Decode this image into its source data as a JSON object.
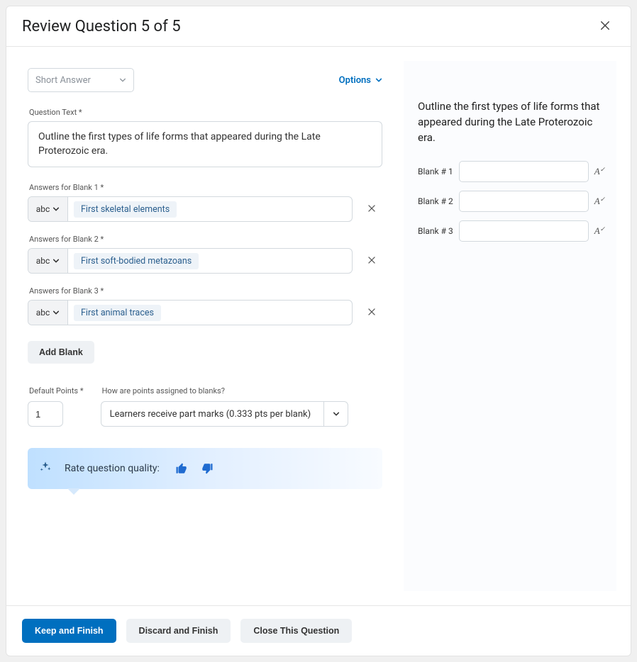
{
  "header": {
    "title": "Review Question 5 of 5"
  },
  "editor": {
    "question_type": "Short Answer",
    "options_label": "Options",
    "question_text_label": "Question Text *",
    "question_text": "Outline the first types of life forms that appeared during the Late Proterozoic era.",
    "blanks": [
      {
        "label": "Answers for Blank 1 *",
        "mode": "abc",
        "answer": "First skeletal elements"
      },
      {
        "label": "Answers for Blank 2 *",
        "mode": "abc",
        "answer": "First soft-bodied metazoans"
      },
      {
        "label": "Answers for Blank 3 *",
        "mode": "abc",
        "answer": "First animal traces"
      }
    ],
    "add_blank_label": "Add Blank",
    "points": {
      "label": "Default Points *",
      "value": "1"
    },
    "scoring": {
      "label": "How are points assigned to blanks?",
      "value": "Learners receive part marks (0.333 pts per blank)"
    },
    "rating_prompt": "Rate question quality:"
  },
  "preview": {
    "question_text": "Outline the first types of life forms that appeared during the Late Proterozoic era.",
    "blanks": [
      {
        "label": "Blank # 1"
      },
      {
        "label": "Blank # 2"
      },
      {
        "label": "Blank # 3"
      }
    ]
  },
  "footer": {
    "keep": "Keep and Finish",
    "discard": "Discard and Finish",
    "close": "Close This Question"
  }
}
